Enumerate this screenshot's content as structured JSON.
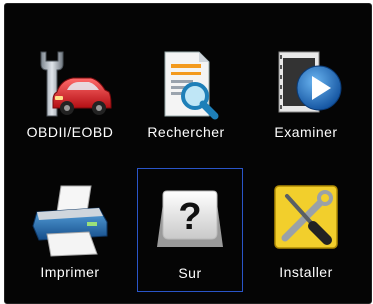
{
  "menu": {
    "items": [
      {
        "label": "OBDII/EOBD",
        "icon": "wrench-car-icon"
      },
      {
        "label": "Rechercher",
        "icon": "document-search-icon"
      },
      {
        "label": "Examiner",
        "icon": "film-play-icon"
      },
      {
        "label": "Imprimer",
        "icon": "printer-icon"
      },
      {
        "label": "Sur",
        "icon": "question-key-icon",
        "selected": true
      },
      {
        "label": "Installer",
        "icon": "tools-icon"
      }
    ]
  },
  "colors": {
    "background": "#050505",
    "selection_border": "#2a55c8",
    "label_text": "#ffffff"
  }
}
